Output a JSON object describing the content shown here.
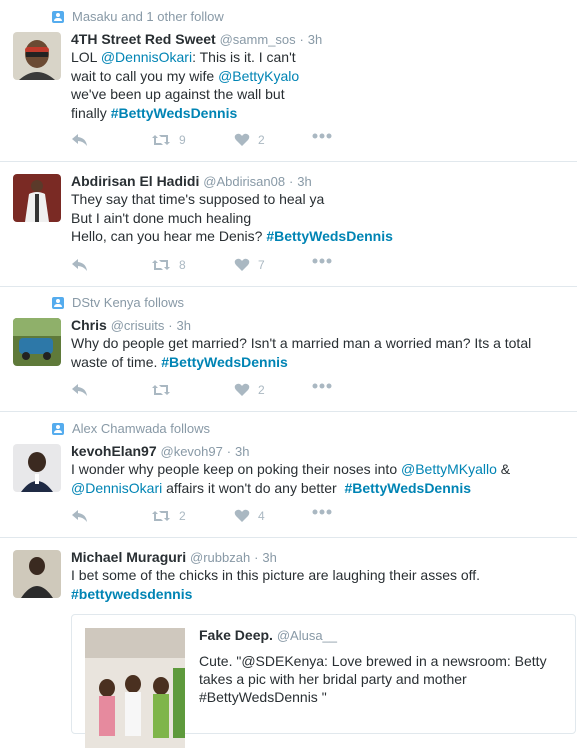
{
  "colors": {
    "link": "#0084b4",
    "muted": "#8899a6",
    "icon": "#aab8c2",
    "context_icon": "#55acee"
  },
  "tweets": [
    {
      "context": "Masaku and 1 other follow",
      "name": "4TH Street Red Sweet",
      "handle": "@samm_sos",
      "dot": "·",
      "time": "3h",
      "lines": [
        {
          "t1": "LOL ",
          "l1": "@DennisOkari",
          "t2": ": This is it. I can't"
        },
        {
          "t1": "wait to call you my wife ",
          "l1": "@BettyKyalo",
          "t2": ""
        },
        {
          "t1": "we've been up against the wall but",
          "l1": "",
          "t2": ""
        },
        {
          "t1": "finally ",
          "l1": "",
          "t2": "",
          "h": "#BettyWedsDennis"
        }
      ],
      "retweets": "9",
      "likes": "2"
    },
    {
      "name": "Abdirisan El Hadidi",
      "handle": "@Abdirisan08",
      "dot": "·",
      "time": "3h",
      "line1": "They say that time's supposed to heal ya",
      "line2": "But I ain't done much healing",
      "line3": "Hello, can you hear me Denis? ",
      "hashtag": "#BettyWedsDennis",
      "retweets": "8",
      "likes": "7"
    },
    {
      "context": "DStv Kenya follows",
      "name": "Chris",
      "handle": "@crisuits",
      "dot": "·",
      "time": "3h",
      "line1": "Why do people get married? Isn't a married man a worried man? Its a total",
      "line2": "waste of time. ",
      "hashtag": "#BettyWedsDennis",
      "retweets": "",
      "likes": "2"
    },
    {
      "context": "Alex Chamwada follows",
      "name": "kevohElan97",
      "handle": "@kevoh97",
      "dot": "·",
      "time": "3h",
      "line1_a": "I wonder why people keep on poking their noses into ",
      "line1_link": "@BettyMKyallo",
      "line1_b": " &",
      "line2_link": "@DennisOkari",
      "line2_a": " affairs it won't do any better  ",
      "hashtag": "#BettyWedsDennis",
      "retweets": "2",
      "likes": "4"
    },
    {
      "name": "Michael Muraguri",
      "handle": "@rubbzah",
      "dot": "·",
      "time": "3h",
      "line1": "I bet some of the chicks in this picture are laughing their asses off.",
      "hashtag": "#bettywedsdennis",
      "quote": {
        "name": "Fake Deep.",
        "handle": "@Alusa__",
        "text": "Cute. \"@SDEKenya: Love brewed in a newsroom: Betty takes a pic with her bridal party and mother #BettyWedsDennis \""
      }
    }
  ]
}
